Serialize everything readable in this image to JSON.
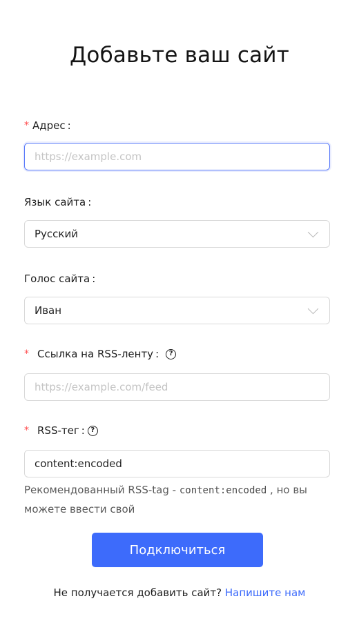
{
  "page": {
    "title": "Добавьте ваш сайт"
  },
  "form": {
    "address": {
      "required_mark": "*",
      "label": "Адрес",
      "colon": ":",
      "placeholder": "https://example.com",
      "value": ""
    },
    "language": {
      "label": "Язык сайта",
      "colon": ":",
      "selected": "Русский"
    },
    "voice": {
      "label": "Голос сайта",
      "colon": ":",
      "selected": "Иван"
    },
    "rss_link": {
      "required_mark": "*",
      "label": "Ссылка на RSS-ленту",
      "colon": ":",
      "help_icon": "question-circle-icon",
      "help_glyph": "?",
      "placeholder": "https://example.com/feed",
      "value": ""
    },
    "rss_tag": {
      "required_mark": "*",
      "label": "RSS-тег",
      "colon": ":",
      "help_icon": "question-circle-icon",
      "help_glyph": "?",
      "value": "content:encoded",
      "hint_prefix": "Рекомендованный RSS-tag - ",
      "hint_code": "content:encoded",
      "hint_suffix": " , но вы можете ввести свой"
    },
    "submit_label": "Подключиться"
  },
  "footer": {
    "text": "Не получается добавить сайт? ",
    "link_text": "Напишите нам"
  },
  "colors": {
    "accent": "#3d6bfb",
    "required": "#ff4d4f",
    "border": "#d9d9d9",
    "focus_border": "#5b7cfa"
  }
}
